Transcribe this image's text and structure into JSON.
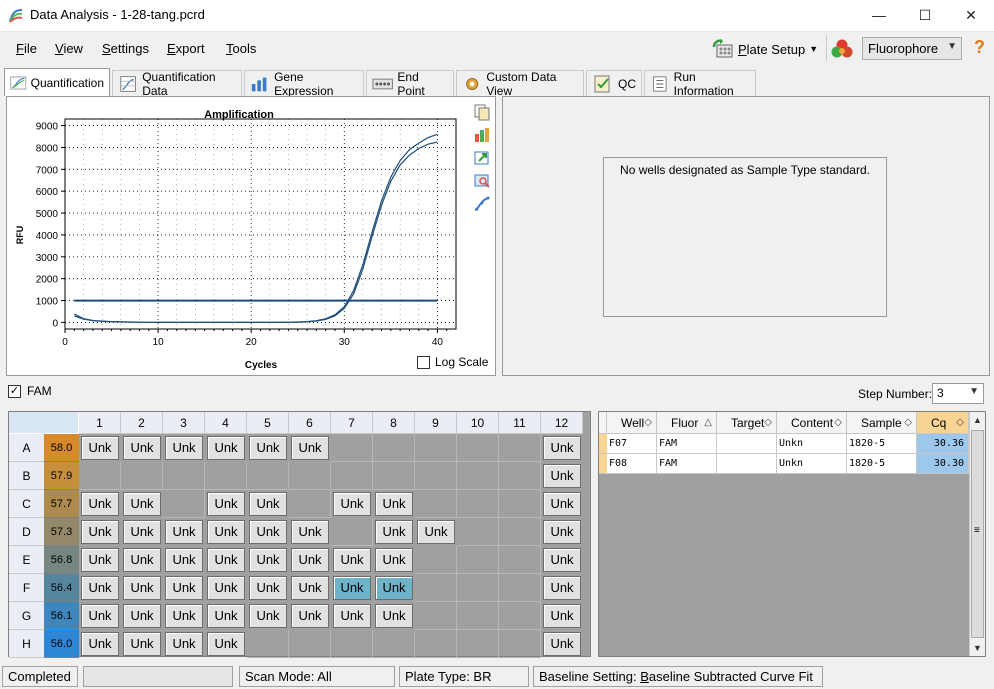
{
  "window": {
    "title": "Data Analysis - 1-28-tang.pcrd",
    "min_glyph": "—",
    "max_glyph": "☐",
    "close_glyph": "✕"
  },
  "menu": {
    "file": {
      "accel": "F",
      "rest": "ile"
    },
    "view": {
      "accel": "V",
      "rest": "iew"
    },
    "settings": {
      "accel": "S",
      "rest": "ettings"
    },
    "export": {
      "accel": "E",
      "rest": "xport"
    },
    "tools": {
      "accel": "T",
      "rest": "ools"
    }
  },
  "toolbar": {
    "plate_setup_accel": "P",
    "plate_setup_rest": "late Setup",
    "fluorophore": "Fluorophore",
    "help_glyph": "?"
  },
  "tabs": [
    "Quantification",
    "Quantification Data",
    "Gene Expression",
    "End Point",
    "Custom Data View",
    "QC",
    "Run Information"
  ],
  "standard_curve_message": "No wells designated as Sample Type standard.",
  "log_scale_label": "Log Scale",
  "fluor_filter": {
    "label": "FAM",
    "check_glyph": "✓"
  },
  "step_number": {
    "label": "Step Number:",
    "value": "3"
  },
  "chart_data": {
    "type": "line",
    "title": "Amplification",
    "xlabel": "Cycles",
    "ylabel": "RFU",
    "xlim": [
      0,
      42
    ],
    "ylim": [
      -300,
      9300
    ],
    "x_ticks": [
      0,
      10,
      20,
      30,
      40
    ],
    "y_ticks": [
      0,
      1000,
      2000,
      3000,
      4000,
      5000,
      6000,
      7000,
      8000,
      9000
    ],
    "grid": true,
    "threshold": 1000,
    "series": [
      {
        "x": [
          1,
          2,
          3,
          4,
          5,
          6,
          7,
          8,
          9,
          10,
          11,
          12,
          13,
          14,
          15,
          16,
          17,
          18,
          19,
          20,
          21,
          22,
          23,
          24,
          25,
          26,
          27,
          28,
          29,
          30,
          31,
          32,
          33,
          34,
          35,
          36,
          37,
          38,
          39,
          40
        ],
        "values": [
          380,
          170,
          90,
          60,
          40,
          30,
          20,
          10,
          5,
          0,
          0,
          0,
          0,
          0,
          0,
          0,
          0,
          0,
          0,
          0,
          0,
          0,
          0,
          10,
          20,
          40,
          80,
          170,
          350,
          720,
          1450,
          2650,
          4150,
          5550,
          6650,
          7400,
          7900,
          8200,
          8450,
          8600
        ]
      },
      {
        "x": [
          1,
          2,
          3,
          4,
          5,
          6,
          7,
          8,
          9,
          10,
          11,
          12,
          13,
          14,
          15,
          16,
          17,
          18,
          19,
          20,
          21,
          22,
          23,
          24,
          25,
          26,
          27,
          28,
          29,
          30,
          31,
          32,
          33,
          34,
          35,
          36,
          37,
          38,
          39,
          40
        ],
        "values": [
          300,
          150,
          80,
          50,
          35,
          25,
          15,
          8,
          4,
          0,
          0,
          0,
          0,
          0,
          0,
          0,
          0,
          0,
          0,
          0,
          0,
          0,
          0,
          8,
          15,
          30,
          65,
          140,
          300,
          640,
          1300,
          2450,
          3950,
          5350,
          6450,
          7200,
          7650,
          7950,
          8150,
          8250
        ]
      }
    ],
    "colors": {
      "series": "#1f4e79",
      "threshold": "#1a4b80"
    }
  },
  "plate": {
    "columns": [
      "1",
      "2",
      "3",
      "4",
      "5",
      "6",
      "7",
      "8",
      "9",
      "10",
      "11",
      "12"
    ],
    "rows": [
      {
        "label": "A",
        "temp": "58.0",
        "color": "#d88a2a",
        "wells": [
          "Unk",
          "Unk",
          "Unk",
          "Unk",
          "Unk",
          "Unk",
          "",
          "",
          "",
          "",
          "",
          "Unk"
        ]
      },
      {
        "label": "B",
        "temp": "57.9",
        "color": "#c68f3a",
        "wells": [
          "",
          "",
          "",
          "",
          "",
          "",
          "",
          "",
          "",
          "",
          "",
          "Unk"
        ]
      },
      {
        "label": "C",
        "temp": "57.7",
        "color": "#ad8b4e",
        "wells": [
          "Unk",
          "Unk",
          "",
          "Unk",
          "Unk",
          "",
          "Unk",
          "Unk",
          "",
          "",
          "",
          "Unk"
        ]
      },
      {
        "label": "D",
        "temp": "57.3",
        "color": "#93886a",
        "wells": [
          "Unk",
          "Unk",
          "Unk",
          "Unk",
          "Unk",
          "Unk",
          "",
          "Unk",
          "Unk",
          "",
          "",
          "Unk"
        ]
      },
      {
        "label": "E",
        "temp": "56.8",
        "color": "#768781",
        "wells": [
          "Unk",
          "Unk",
          "Unk",
          "Unk",
          "Unk",
          "Unk",
          "Unk",
          "Unk",
          "",
          "",
          "",
          "Unk"
        ]
      },
      {
        "label": "F",
        "temp": "56.4",
        "color": "#55869e",
        "wells": [
          "Unk",
          "Unk",
          "Unk",
          "Unk",
          "Unk",
          "Unk",
          "Unk",
          "Unk",
          "",
          "",
          "",
          "Unk"
        ]
      },
      {
        "label": "G",
        "temp": "56.1",
        "color": "#3e86bb",
        "wells": [
          "Unk",
          "Unk",
          "Unk",
          "Unk",
          "Unk",
          "Unk",
          "Unk",
          "Unk",
          "",
          "",
          "",
          "Unk"
        ]
      },
      {
        "label": "H",
        "temp": "56.0",
        "color": "#2e86d6",
        "wells": [
          "Unk",
          "Unk",
          "Unk",
          "Unk",
          "",
          "",
          "",
          "",
          "",
          "",
          "",
          "Unk"
        ]
      }
    ],
    "selected": [
      "F7",
      "F8"
    ]
  },
  "well_table": {
    "headers": [
      "Well",
      "Fluor",
      "Target",
      "Content",
      "Sample",
      "Cq"
    ],
    "sort_glyphs": [
      "◇",
      "△",
      "◇",
      "◇",
      "◇",
      "◇"
    ],
    "rows": [
      {
        "well": "F07",
        "fluor": "FAM",
        "target": "",
        "content": "Unkn",
        "sample": "1820-5",
        "cq": "30.36"
      },
      {
        "well": "F08",
        "fluor": "FAM",
        "target": "",
        "content": "Unkn",
        "sample": "1820-5",
        "cq": "30.30"
      }
    ],
    "scroll_up": "▲",
    "scroll_down": "▼",
    "scroll_grip": "≡"
  },
  "status": {
    "state": "Completed",
    "scan_mode": "Scan Mode: All Channels",
    "plate_type": "Plate Type: BR Clear",
    "baseline_prefix": "Baseline Setting: ",
    "baseline_accel": "B",
    "baseline_rest": "aseline Subtracted Curve Fit"
  }
}
